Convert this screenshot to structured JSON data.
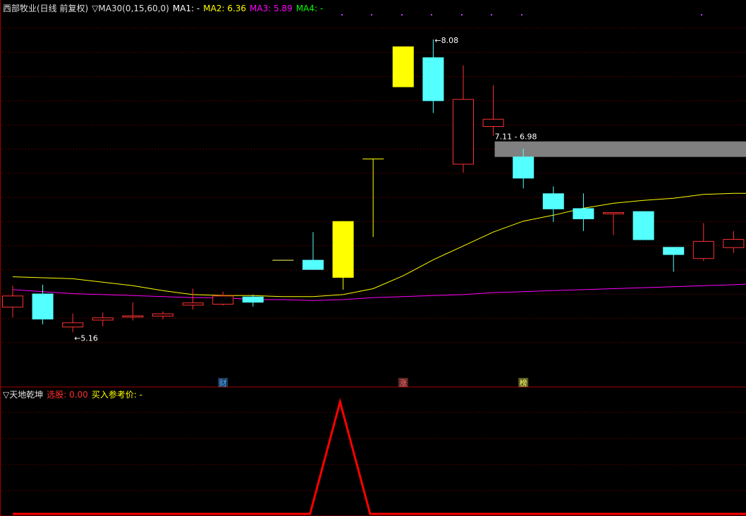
{
  "header": {
    "title": "西部牧业(日线 前复权)",
    "indicator": "▽MA30(0,15,60,0)",
    "ma1": "MA1: -",
    "ma2": "MA2: 6.36",
    "ma3": "MA3: 5.89",
    "ma4": "MA4: -"
  },
  "sub_header": {
    "title": "▽天地乾坤",
    "select_label": "选股: 0.00",
    "buy_label": "买入参考价: -"
  },
  "colors": {
    "background": "#000000",
    "grid": "#8a0000",
    "border": "#a00000",
    "up_candle": "#ff3232",
    "down_candle": "#54ffff",
    "limit_up_candle": "#ffff00",
    "ma2": "#ffff00",
    "ma3": "#ff00ff",
    "ma4": "#00ff00",
    "signal_line": "#ff0000",
    "gap_box": "#808080"
  },
  "chart_data": [
    {
      "type": "candlestick",
      "title": "西部牧业(日线 前复权)",
      "ylim": [
        4.7,
        8.35
      ],
      "annotations": {
        "high_label": "8.08",
        "low_label": "5.16",
        "gap_label": "7.11 - 6.98"
      },
      "gap": {
        "from_index": 16,
        "high": 7.11,
        "low": 6.98
      },
      "candles": [
        {
          "open": 5.38,
          "high": 5.6,
          "low": 5.28,
          "close": 5.5,
          "color": "up"
        },
        {
          "open": 5.52,
          "high": 5.61,
          "low": 5.21,
          "close": 5.26,
          "color": "down"
        },
        {
          "open": 5.18,
          "high": 5.32,
          "low": 5.13,
          "close": 5.23,
          "color": "up"
        },
        {
          "open": 5.25,
          "high": 5.33,
          "low": 5.19,
          "close": 5.28,
          "color": "up"
        },
        {
          "open": 5.28,
          "high": 5.43,
          "low": 5.25,
          "close": 5.3,
          "color": "up"
        },
        {
          "open": 5.29,
          "high": 5.34,
          "low": 5.26,
          "close": 5.32,
          "color": "up"
        },
        {
          "open": 5.4,
          "high": 5.57,
          "low": 5.36,
          "close": 5.43,
          "color": "up"
        },
        {
          "open": 5.41,
          "high": 5.54,
          "low": 5.4,
          "close": 5.5,
          "color": "up"
        },
        {
          "open": 5.49,
          "high": 5.51,
          "low": 5.39,
          "close": 5.43,
          "color": "down"
        },
        {
          "open": 5.86,
          "high": 5.86,
          "low": 5.86,
          "close": 5.86,
          "color": "flat"
        },
        {
          "open": 5.86,
          "high": 6.14,
          "low": 5.76,
          "close": 5.76,
          "color": "down"
        },
        {
          "open": 5.68,
          "high": 6.25,
          "low": 5.56,
          "close": 6.25,
          "color": "limit_up"
        },
        {
          "open": 6.88,
          "high": 6.88,
          "low": 6.09,
          "close": 6.88,
          "color": "limit_up"
        },
        {
          "open": 7.6,
          "high": 8.01,
          "low": 7.6,
          "close": 8.01,
          "color": "limit_up"
        },
        {
          "open": 7.9,
          "high": 8.08,
          "low": 7.34,
          "close": 7.46,
          "color": "down"
        },
        {
          "open": 6.82,
          "high": 7.82,
          "low": 6.74,
          "close": 7.48,
          "color": "up"
        },
        {
          "open": 7.2,
          "high": 7.62,
          "low": 7.11,
          "close": 7.28,
          "color": "up"
        },
        {
          "open": 6.9,
          "high": 6.98,
          "low": 6.58,
          "close": 6.68,
          "color": "down"
        },
        {
          "open": 6.53,
          "high": 6.6,
          "low": 6.24,
          "close": 6.37,
          "color": "down"
        },
        {
          "open": 6.38,
          "high": 6.53,
          "low": 6.15,
          "close": 6.27,
          "color": "down"
        },
        {
          "open": 6.34,
          "high": 6.34,
          "low": 6.11,
          "close": 6.32,
          "color": "up"
        },
        {
          "open": 6.35,
          "high": 6.35,
          "low": 6.06,
          "close": 6.06,
          "color": "down"
        },
        {
          "open": 5.99,
          "high": 5.99,
          "low": 5.74,
          "close": 5.91,
          "color": "down"
        },
        {
          "open": 5.87,
          "high": 6.23,
          "low": 5.85,
          "close": 6.05,
          "color": "up"
        },
        {
          "open": 5.98,
          "high": 6.15,
          "low": 5.93,
          "close": 6.07,
          "color": "up"
        }
      ],
      "series": [
        {
          "name": "MA2",
          "x": [
            0,
            2,
            4,
            5,
            6,
            7,
            8,
            9,
            10,
            11,
            12,
            13,
            14,
            15,
            16,
            17,
            18,
            19,
            20,
            21,
            22,
            23,
            24,
            24.8
          ],
          "values": [
            5.69,
            5.67,
            5.6,
            5.55,
            5.51,
            5.5,
            5.5,
            5.49,
            5.49,
            5.51,
            5.57,
            5.7,
            5.86,
            6.0,
            6.14,
            6.25,
            6.31,
            6.38,
            6.43,
            6.46,
            6.48,
            6.52,
            6.53,
            6.53
          ]
        },
        {
          "name": "MA3",
          "x": [
            0,
            1,
            2,
            3,
            4,
            5,
            6,
            7,
            8,
            9,
            10,
            11,
            12,
            13,
            14,
            15,
            16,
            17,
            18,
            19,
            20,
            21,
            22,
            23,
            24,
            24.8
          ],
          "values": [
            5.56,
            5.54,
            5.52,
            5.51,
            5.5,
            5.49,
            5.48,
            5.48,
            5.46,
            5.46,
            5.45,
            5.46,
            5.48,
            5.49,
            5.5,
            5.51,
            5.53,
            5.54,
            5.55,
            5.56,
            5.57,
            5.58,
            5.59,
            5.6,
            5.61,
            5.62
          ]
        }
      ],
      "x_markers": [
        {
          "index": 7,
          "label": "财",
          "color": "#4fa8ff"
        },
        {
          "index": 13,
          "label": "涨",
          "color": "#ff6a6a"
        },
        {
          "index": 17,
          "label": "榜",
          "color": "#ffff66"
        }
      ]
    },
    {
      "type": "line",
      "title": "▽天地乾坤",
      "ylim": [
        0,
        1
      ],
      "series": [
        {
          "name": "选股",
          "x": [
            0,
            9.9,
            10.9,
            11.9,
            24.8
          ],
          "values": [
            0,
            0,
            1,
            0,
            0
          ]
        }
      ]
    }
  ]
}
